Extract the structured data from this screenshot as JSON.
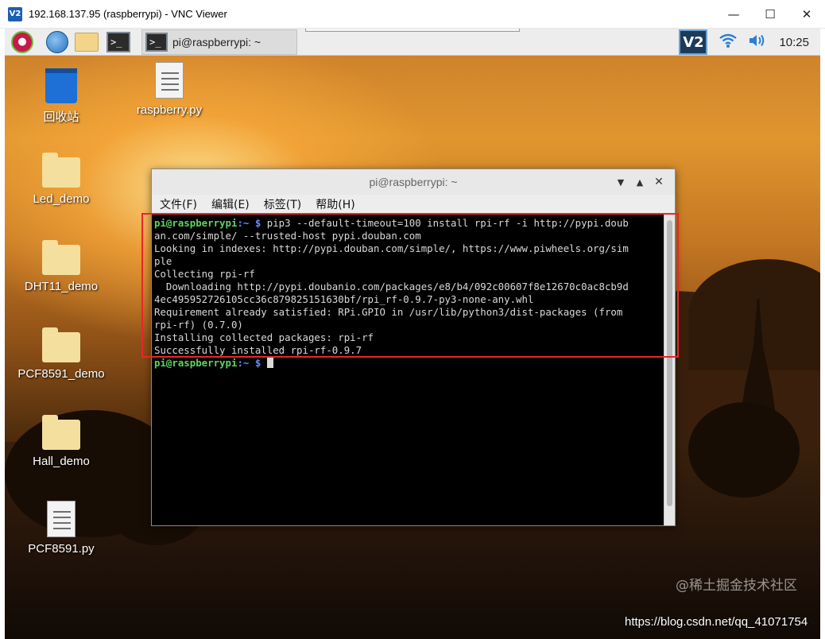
{
  "vnc_window": {
    "logo": "V2",
    "title": "192.168.137.95 (raspberrypi) - VNC Viewer",
    "controls": [
      "—",
      "☐",
      "✕"
    ]
  },
  "panel": {
    "launcher_icons": [
      "raspberry-menu-icon",
      "web-browser-icon",
      "file-manager-icon",
      "terminal-icon"
    ],
    "task": {
      "label": "pi@raspberrypi: ~"
    },
    "tray": {
      "vnc_label": "V2",
      "clock": "10:25"
    }
  },
  "desktop_icons": [
    {
      "label": "回收站",
      "type": "trash"
    },
    {
      "label": "raspberry.py",
      "type": "file"
    },
    {
      "label": "Led_demo",
      "type": "folder"
    },
    {
      "label": "DHT11_demo",
      "type": "folder"
    },
    {
      "label": "PCF8591_demo",
      "type": "folder"
    },
    {
      "label": "Hall_demo",
      "type": "folder"
    },
    {
      "label": "PCF8591.py",
      "type": "file"
    }
  ],
  "terminal": {
    "title": "pi@raspberrypi: ~",
    "menu": [
      "文件(F)",
      "编辑(E)",
      "标签(T)",
      "帮助(H)"
    ],
    "prompt_user": "pi@raspberrypi",
    "prompt_path": ":~ $ ",
    "command_line_1": "pip3 --default-timeout=100 install rpi-rf -i http://pypi.doub",
    "output": [
      "an.com/simple/ --trusted-host pypi.douban.com",
      "Looking in indexes: http://pypi.douban.com/simple/, https://www.piwheels.org/sim",
      "ple",
      "Collecting rpi-rf",
      "  Downloading http://pypi.doubanio.com/packages/e8/b4/092c00607f8e12670c0ac8cb9d",
      "4ec495952726105cc36c879825151630bf/rpi_rf-0.9.7-py3-none-any.whl",
      "Requirement already satisfied: RPi.GPIO in /usr/lib/python3/dist-packages (from",
      "rpi-rf) (0.7.0)",
      "Installing collected packages: rpi-rf",
      "Successfully installed rpi-rf-0.9.7"
    ]
  },
  "watermark": {
    "juejin": "@稀土掘金技术社区",
    "csdn": "https://blog.csdn.net/qq_41071754"
  },
  "colors": {
    "highlight": "#e8262b",
    "prompt_user": "#5fd35f",
    "prompt_path": "#5f8fff"
  }
}
